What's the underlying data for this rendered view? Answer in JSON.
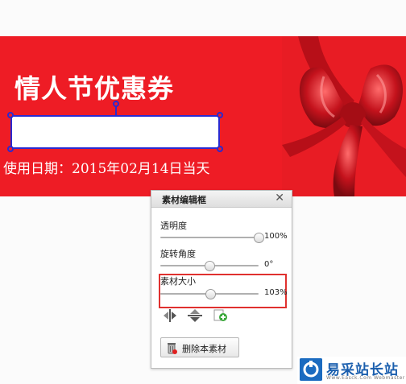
{
  "banner": {
    "title": "情人节优惠券",
    "date_text": "使用日期：2015年02月14日当天",
    "bow_image": "red-ribbon-bow-image",
    "background_color": "#ee1c25"
  },
  "selection": {
    "handle_color": "#2a2ad0"
  },
  "panel": {
    "title": "素材编辑框",
    "close_icon": "close-icon",
    "sliders": [
      {
        "label": "透明度",
        "value": 100,
        "display": "100%"
      },
      {
        "label": "旋转角度",
        "value": 0,
        "display": "0°"
      },
      {
        "label": "素材大小",
        "value": 103,
        "display": "103%"
      }
    ],
    "tools": [
      "flip-horizontal-icon",
      "flip-vertical-icon",
      "add-layer-icon"
    ],
    "delete_button_label": "删除本素材",
    "delete_icon": "trash-icon",
    "highlight_color": "#e0312f"
  },
  "watermark": {
    "name": "易采站长站",
    "url": "Www.Easck.Com  Webmaster",
    "logo_icon": "easck-logo-icon",
    "brand_color": "#1b6bc0"
  }
}
